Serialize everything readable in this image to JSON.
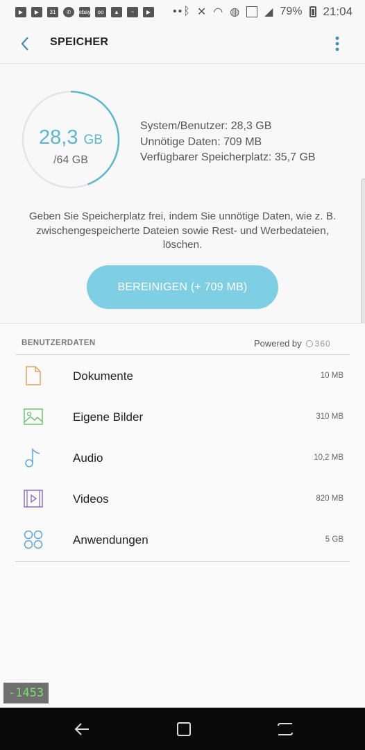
{
  "status_bar": {
    "battery": "79%",
    "time": "21:04",
    "notif_icons": [
      "youtube-icon",
      "youtube-icon",
      "calendar-icon",
      "whatsapp-icon",
      "ebay-icon",
      "voicemail-icon",
      "image-icon",
      "activity-icon",
      "youtube-icon"
    ],
    "calendar_day": "31",
    "ebay_label": "ebay",
    "overflow": "••"
  },
  "header": {
    "title": "SPEICHER"
  },
  "usage": {
    "used_value": "28,3",
    "used_unit": "GB",
    "total": "/64 GB",
    "used_fraction": 0.442,
    "accent_color": "#5bb7cf",
    "system_user": "System/Benutzer: 28,3 GB",
    "unnecessary": "Unnötige Daten: 709 MB",
    "available": "Verfügbarer Speicherplatz: 35,7 GB"
  },
  "description": "Geben Sie Speicherplatz frei, indem Sie unnötige Daten, wie z. B. zwischengespeicherte Dateien sowie Rest- und Werbedateien, löschen.",
  "clean_button": {
    "label": "BEREINIGEN (+ 709 MB)",
    "color": "#7fcfe4"
  },
  "user_data": {
    "heading": "BENUTZERDATEN",
    "powered_by": "Powered by",
    "brand": "360",
    "items": [
      {
        "name": "Dokumente",
        "size": "10 MB",
        "icon": "document-icon",
        "color": "#e5a25a"
      },
      {
        "name": "Eigene Bilder",
        "size": "310 MB",
        "icon": "image-icon",
        "color": "#6cc26f"
      },
      {
        "name": "Audio",
        "size": "10,2 MB",
        "icon": "music-note-icon",
        "color": "#5aa6d6"
      },
      {
        "name": "Videos",
        "size": "820 MB",
        "icon": "video-icon",
        "color": "#8a6fc4"
      },
      {
        "name": "Anwendungen",
        "size": "5 GB",
        "icon": "apps-icon",
        "color": "#5aa6d6"
      }
    ]
  },
  "overlay_badge": "-1453"
}
